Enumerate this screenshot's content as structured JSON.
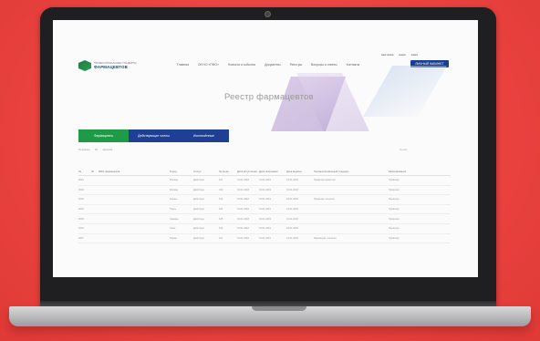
{
  "header": {
    "logo_top": "ПРОФЕССИОНАЛЬНЫЕ СТАНДАРТЫ",
    "logo_main": "ФАРМАЦЕВТОВ",
    "topbar": [
      "■■■ ■■■■",
      "■■■■",
      "■■■■"
    ],
    "nav": [
      {
        "label": "Главная"
      },
      {
        "label": "Об НО «ПФО»"
      },
      {
        "label": "Новости и события"
      },
      {
        "label": "Документы"
      },
      {
        "label": "Реестры"
      },
      {
        "label": "Вопросы и ответы"
      },
      {
        "label": "Контакты"
      }
    ],
    "cabinet_button": "ЛИЧНЫЙ КАБИНЕТ"
  },
  "hero": {
    "title": "Реестр фармацевтов"
  },
  "tabs": [
    {
      "label": "Фармацевты",
      "color": "#1f9b47"
    },
    {
      "label": "Действующие члены",
      "color": "#1e3f93"
    },
    {
      "label": "Исключённые",
      "color": "#1e3f93"
    }
  ],
  "filters": {
    "left": [
      "Показать",
      "10",
      "записей"
    ],
    "right": "Поиск:"
  },
  "table": {
    "columns": [
      "№",
      "ID",
      "ФИО фармацевта",
      "Город",
      "Статус",
      "№ св-ва",
      "Дата вступления",
      "Дата окончания",
      "Дата выдачи",
      "Профессиональный стандарт",
      "Квалификация"
    ],
    "rows": [
      [
        "0001",
        "",
        "",
        "Москва",
        "Действует",
        "101",
        "01.01.2018",
        "01.01.2019",
        "01.01.2018",
        "Провизор-аналитик",
        "Провизор"
      ],
      [
        "0002",
        "",
        "",
        "Москва",
        "Действует",
        "102",
        "01.01.2018",
        "01.01.2019",
        "01.01.2018",
        "",
        "Провизор"
      ],
      [
        "0003",
        "",
        "",
        "Казань",
        "Действует",
        "103",
        "01.01.2018",
        "01.01.2019",
        "01.01.2018",
        "Провизор-технолог",
        "Провизор"
      ],
      [
        "0004",
        "",
        "",
        "Тверь",
        "Действует",
        "104",
        "01.01.2018",
        "01.01.2019",
        "01.01.2018",
        "",
        "Провизор"
      ],
      [
        "0005",
        "",
        "",
        "Самара",
        "Действует",
        "105",
        "01.01.2018",
        "01.01.2019",
        "01.01.2018",
        "",
        "Провизор"
      ],
      [
        "0006",
        "",
        "",
        "Омск",
        "Действует",
        "106",
        "01.01.2018",
        "01.01.2019",
        "01.01.2018",
        "",
        "Провизор"
      ],
      [
        "0007",
        "",
        "",
        "Пермь",
        "Действует",
        "107",
        "01.01.2018",
        "01.01.2019",
        "01.01.2018",
        "Фармацевт-технолог",
        "Провизор"
      ]
    ]
  },
  "colors": {
    "background": "#e9423f",
    "brand_blue": "#1b3f8f",
    "brand_green": "#1f9b47"
  }
}
